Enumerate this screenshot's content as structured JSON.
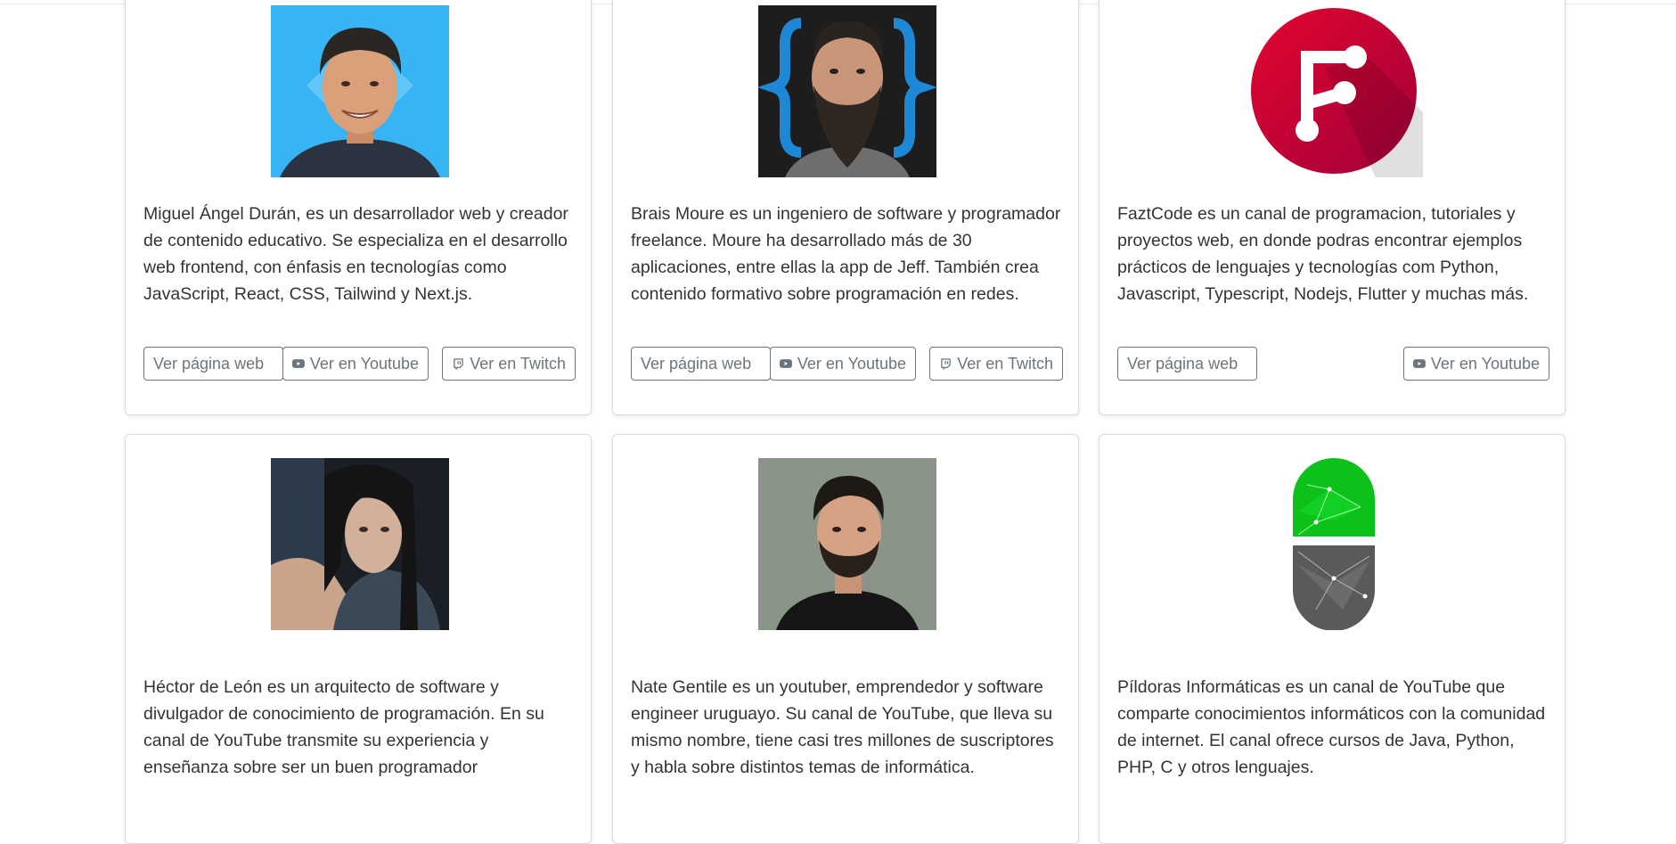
{
  "cards": [
    {
      "description": "Miguel Ángel Durán, es un desarrollador web y creador de contenido educativo. Se especializa en el desarrollo web frontend, con énfasis en tecnologías como JavaScript, React, CSS, Tailwind y Next.js.",
      "buttons": {
        "web": "Ver página web",
        "youtube": "Ver en Youtube",
        "twitch": "Ver en Twitch"
      }
    },
    {
      "description": "Brais Moure es un ingeniero de software y programador freelance. Moure ha desarrollado más de 30 aplicaciones, entre ellas la app de Jeff. También crea contenido formativo sobre programación en redes.",
      "buttons": {
        "web": "Ver página web",
        "youtube": "Ver en Youtube",
        "twitch": "Ver en Twitch"
      }
    },
    {
      "description": "FaztCode es un canal de programacion, tutoriales y proyectos web, en donde podras encontrar ejemplos prácticos de lenguajes y tecnologías com Python, Javascript, Typescript, Nodejs, Flutter y muchas más.",
      "buttons": {
        "web": "Ver página web",
        "youtube": "Ver en Youtube"
      }
    },
    {
      "description": "Héctor de León es un arquitecto de software y divulgador de conocimiento de programación. En su canal de YouTube transmite su experiencia y enseñanza sobre ser un buen programador"
    },
    {
      "description": "Nate Gentile es un youtuber, emprendedor y software engineer uruguayo. Su canal de YouTube, que lleva su mismo nombre, tiene casi tres millones de suscriptores y habla sobre distintos temas de informática."
    },
    {
      "description": "Píldoras Informáticas es un canal de YouTube que comparte conocimientos informáticos con la comunidad de internet. El canal ofrece cursos de Java, Python, PHP, C y otros lenguajes."
    }
  ],
  "icons": {
    "youtube": "youtube-icon",
    "twitch": "twitch-icon"
  },
  "colors": {
    "button_outline": "#6c757d",
    "card_border": "#dcdcdc",
    "text": "#333333"
  }
}
